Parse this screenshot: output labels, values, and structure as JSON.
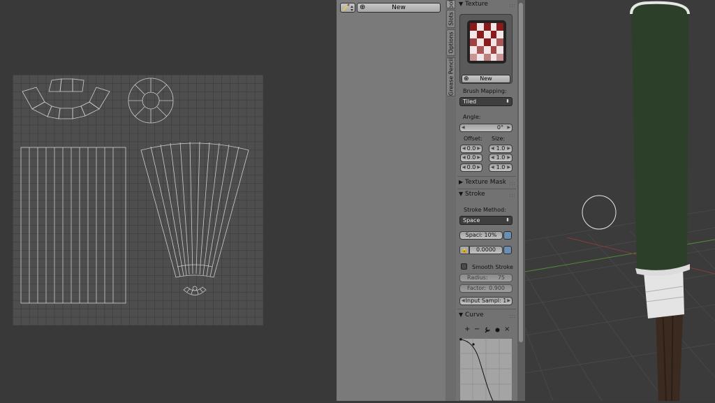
{
  "image_panel": {
    "new_button_label": "New",
    "brush_icon": "brush-icon",
    "add_icon": "plus-icon"
  },
  "tabs": [
    {
      "label": "Tools"
    },
    {
      "label": "Slots"
    },
    {
      "label": "Options"
    },
    {
      "label": "Grease Pencil"
    }
  ],
  "texture_panel": {
    "title": "Texture",
    "new_button_label": "New",
    "brush_mapping_label": "Brush Mapping:",
    "brush_mapping_value": "Tiled",
    "angle_label": "Angle:",
    "angle_value": "0°",
    "offset_label": "Offset:",
    "size_label": "Size:",
    "offset_values": [
      "0.0",
      "0.0",
      "0.0"
    ],
    "size_values": [
      "1.0",
      "1.0",
      "1.0"
    ]
  },
  "texture_mask_panel": {
    "title": "Texture Mask"
  },
  "stroke_panel": {
    "title": "Stroke",
    "stroke_method_label": "Stroke Method:",
    "stroke_method_value": "Space",
    "spacing_label": "Spaci: 10%",
    "jitter_value": "0.0000",
    "smooth_stroke_label": "Smooth Stroke",
    "smooth_stroke_checked": false,
    "radius_label": "Radius:",
    "radius_value": "75",
    "factor_label": "Factor:",
    "factor_value": "0.900",
    "input_samples_label": "Input Sampl: 1"
  },
  "curve_panel": {
    "title": "Curve",
    "tools": [
      "+",
      "−",
      "wrench-icon",
      "dot-icon",
      "×"
    ]
  },
  "colors": {
    "panel_bg": "#727272",
    "dropdown_bg": "#3f3f3f",
    "uv_grid": "#555555",
    "uv_wire": "#cfcfcf",
    "bat_handle": "#2c3f28",
    "bat_wood": "#3a2a20"
  }
}
